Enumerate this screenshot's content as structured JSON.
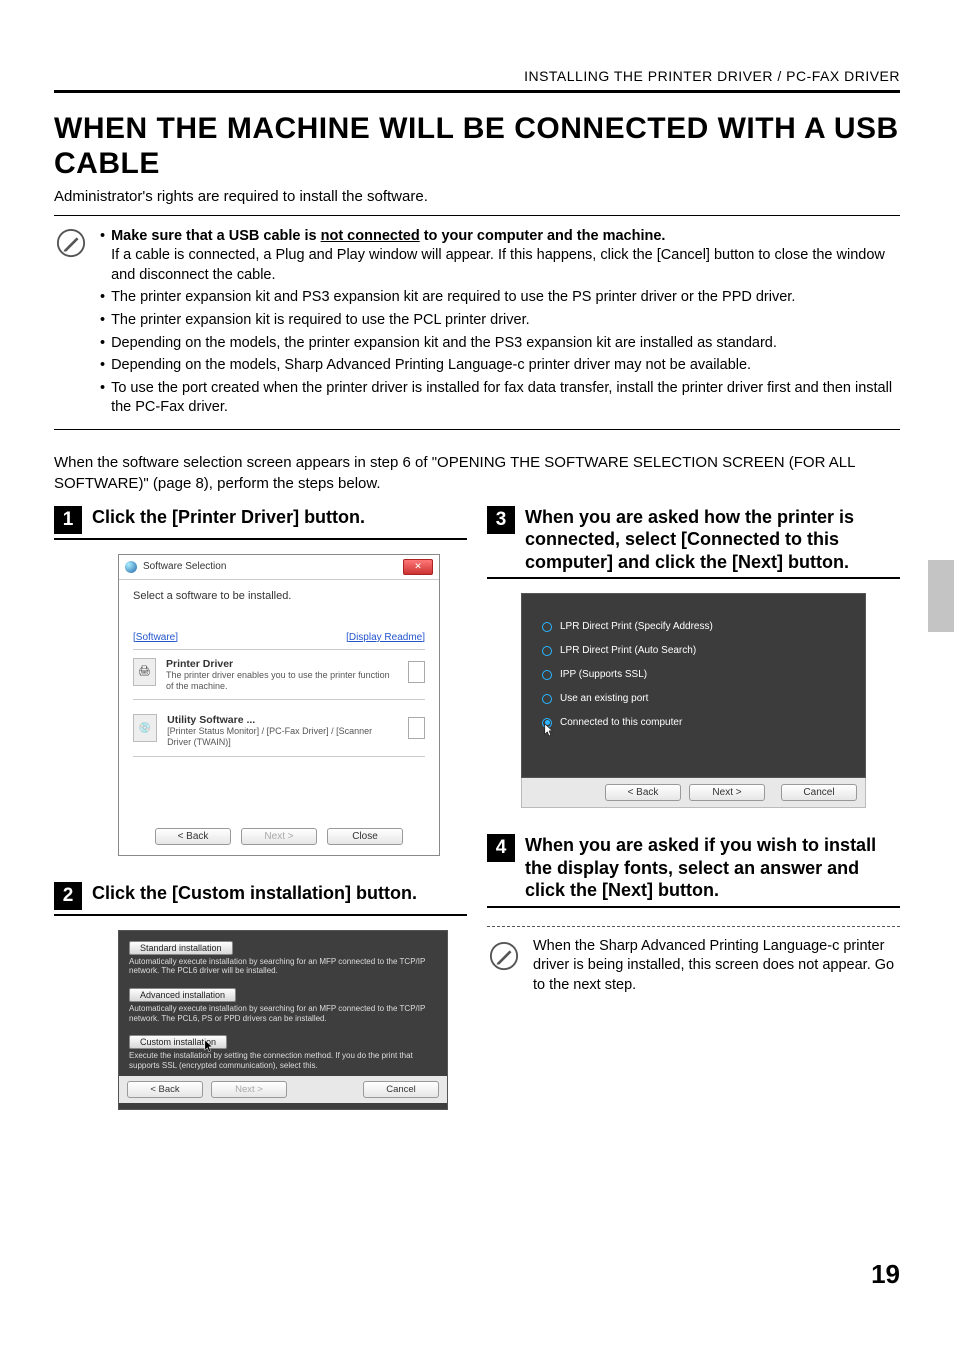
{
  "header": {
    "running": "INSTALLING THE PRINTER DRIVER / PC-FAX DRIVER"
  },
  "title": "WHEN THE MACHINE WILL BE CONNECTED WITH A USB CABLE",
  "intro": "Administrator's rights are required to install the software.",
  "note": {
    "b1_prefix": "Make sure that a USB cable is ",
    "b1_under": "not connected",
    "b1_suffix": " to your computer and the machine.",
    "b1_sub": "If a cable is connected, a Plug and Play window will appear. If this happens, click the [Cancel] button to close the window and disconnect the cable.",
    "b2": "The printer expansion kit and PS3 expansion kit are required to use the PS printer driver or the PPD driver.",
    "b3": "The printer expansion kit is required to use the PCL printer driver.",
    "b4": "Depending on the models, the printer expansion kit and the PS3 expansion kit are installed as standard.",
    "b5": "Depending on the models, Sharp Advanced Printing Language-c printer driver may not be available.",
    "b6": "To use the port created when the printer driver is installed for fax data transfer, install the printer driver first and then install the PC-Fax driver."
  },
  "midtext": "When the software selection screen appears in step 6 of \"OPENING THE SOFTWARE SELECTION SCREEN (FOR ALL SOFTWARE)\" (page 8), perform the steps below.",
  "steps": {
    "s1": {
      "num": "1",
      "title": "Click the [Printer Driver] button."
    },
    "s2": {
      "num": "2",
      "title": "Click the [Custom installation] button."
    },
    "s3": {
      "num": "3",
      "title": "When you are asked how the printer is connected, select [Connected to this computer] and click the [Next] button."
    },
    "s4": {
      "num": "4",
      "title": "When you are asked if you wish to install the display fonts, select an answer and click the [Next] button."
    }
  },
  "shot1": {
    "win_title": "Software Selection",
    "subtitle": "Select a software to be installed.",
    "link_software": "[Software]",
    "link_readme": "[Display Readme]",
    "row1_title": "Printer Driver",
    "row1_desc": "The printer driver enables you to use the printer function of the machine.",
    "row2_title": "Utility Software ...",
    "row2_desc": "[Printer Status Monitor] / [PC-Fax Driver] / [Scanner Driver (TWAIN)]",
    "btn_back": "< Back",
    "btn_next": "Next >",
    "btn_close": "Close"
  },
  "shot2": {
    "c1": "Standard installation",
    "c1d": "Automatically execute installation by searching for an MFP connected to the TCP/IP network. The PCL6 driver will be installed.",
    "c2": "Advanced installation",
    "c2d": "Automatically execute installation by searching for an MFP connected to the TCP/IP network. The PCL6, PS or PPD drivers can be installed.",
    "c3": "Custom installation",
    "c3d": "Execute the installation by setting the connection method. If you do the print that supports SSL (encrypted communication), select this.",
    "btn_back": "< Back",
    "btn_next": "Next >",
    "btn_cancel": "Cancel"
  },
  "shot3": {
    "r1": "LPR Direct Print (Specify Address)",
    "r2": "LPR Direct Print (Auto Search)",
    "r3": "IPP (Supports SSL)",
    "r4": "Use an existing port",
    "r5": "Connected to this computer",
    "btn_back": "< Back",
    "btn_next": "Next >",
    "btn_cancel": "Cancel"
  },
  "subnote": "When the Sharp Advanced Printing Language-c printer driver is being installed, this screen does not appear. Go to the next step.",
  "page_number": "19"
}
